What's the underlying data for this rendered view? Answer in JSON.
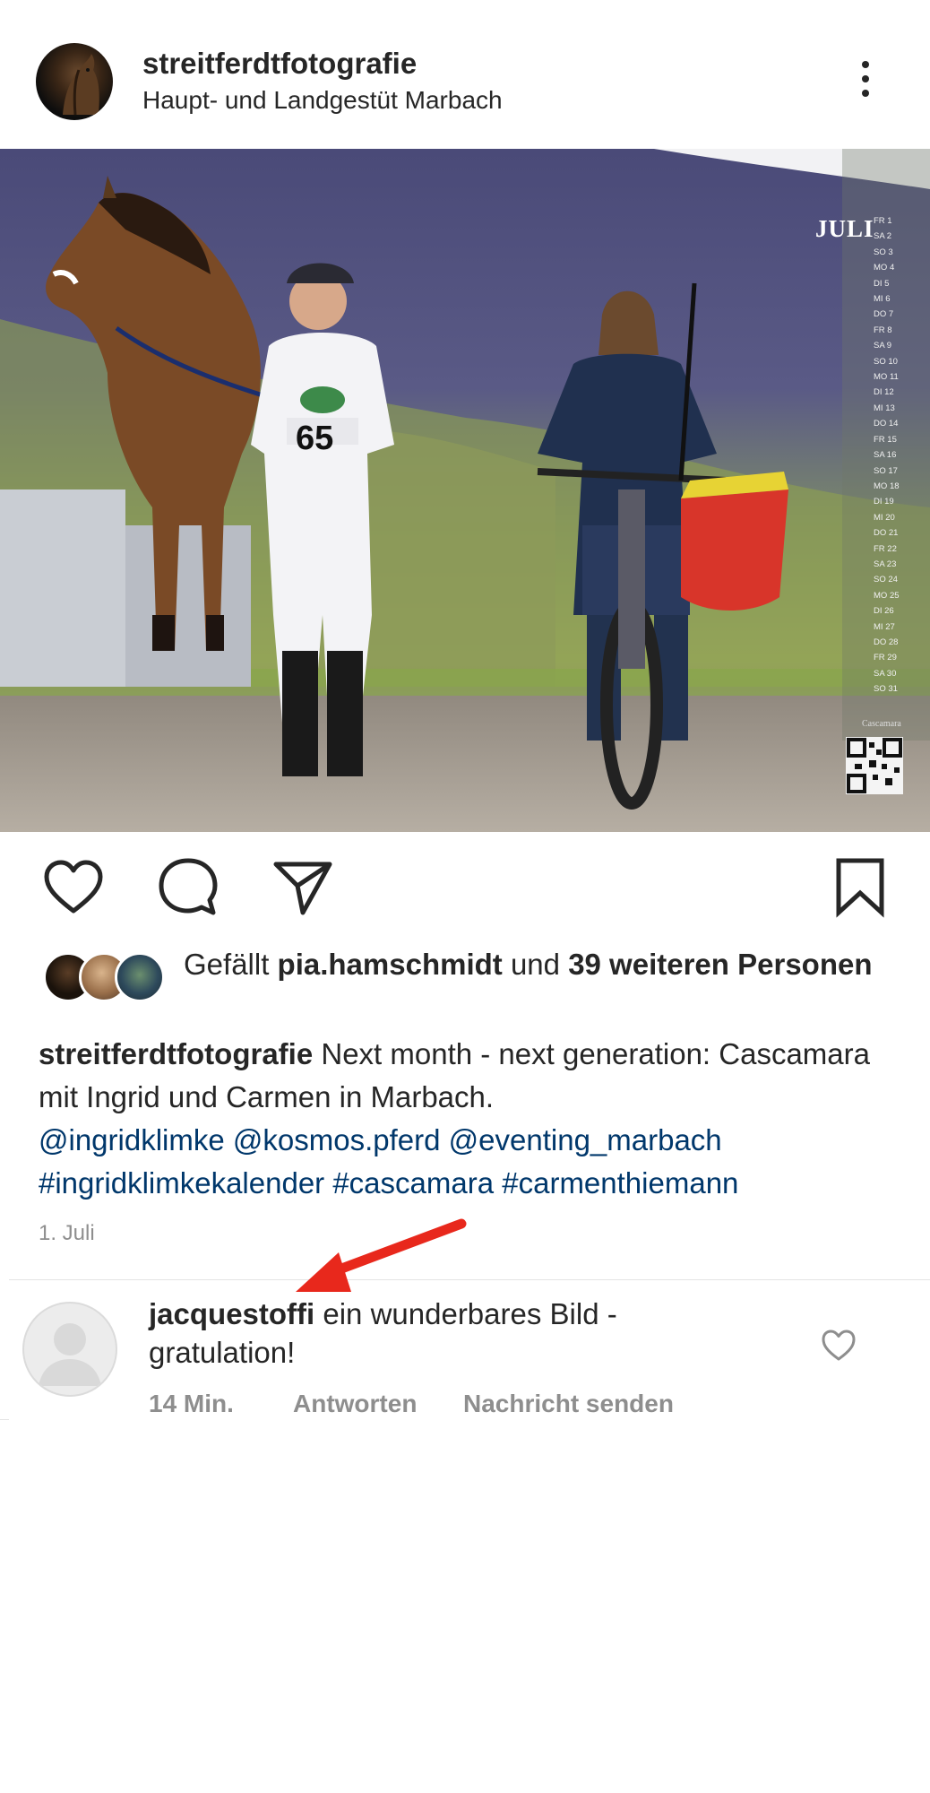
{
  "post": {
    "username": "streitferdtfotografie",
    "location": "Haupt- und Landgestüt Marbach",
    "menu_icon": "more-vertical-icon"
  },
  "calendar_overlay": {
    "month": "JULI",
    "days": [
      "FR 1",
      "SA 2",
      "SO 3",
      "MO 4",
      "DI 5",
      "MI 6",
      "DO 7",
      "FR 8",
      "SA 9",
      "SO 10",
      "MO 11",
      "DI 12",
      "MI 13",
      "DO 14",
      "FR 15",
      "SA 16",
      "SO 17",
      "MO 18",
      "DI 19",
      "MI 20",
      "DO 21",
      "FR 22",
      "SA 23",
      "SO 24",
      "MO 25",
      "DI 26",
      "MI 27",
      "DO 28",
      "FR 29",
      "SA 30",
      "SO 31"
    ],
    "brand": "Cascamara",
    "bib_number": "65"
  },
  "actions": {
    "like_icon": "heart-outline-icon",
    "comment_icon": "comment-bubble-icon",
    "share_icon": "paper-plane-icon",
    "save_icon": "bookmark-icon"
  },
  "likes": {
    "prefix": "Gefällt ",
    "user": "pia.hamschmidt",
    "middle": " und ",
    "count_text": "39 weiteren Personen"
  },
  "caption": {
    "user": "streitferdtfotografie",
    "text": " Next month - next generation: Cascamara mit Ingrid und Carmen in Marbach.",
    "mentions": [
      "@ingridklimke",
      "@kosmos.pferd",
      "@eventing_marbach"
    ],
    "hashtags": [
      "#ingridklimkekalender",
      "#cascamara",
      "#carmenthiemann"
    ],
    "date": "1. Juli"
  },
  "comment": {
    "user": "jacquestoffi",
    "text": " ein wunderbares Bild - gratulation!",
    "time": "14 Min.",
    "reply_label": "Antworten",
    "message_label": "Nachricht senden",
    "like_icon": "small-heart-icon"
  },
  "annotation": {
    "arrow_color": "#e8281c"
  }
}
